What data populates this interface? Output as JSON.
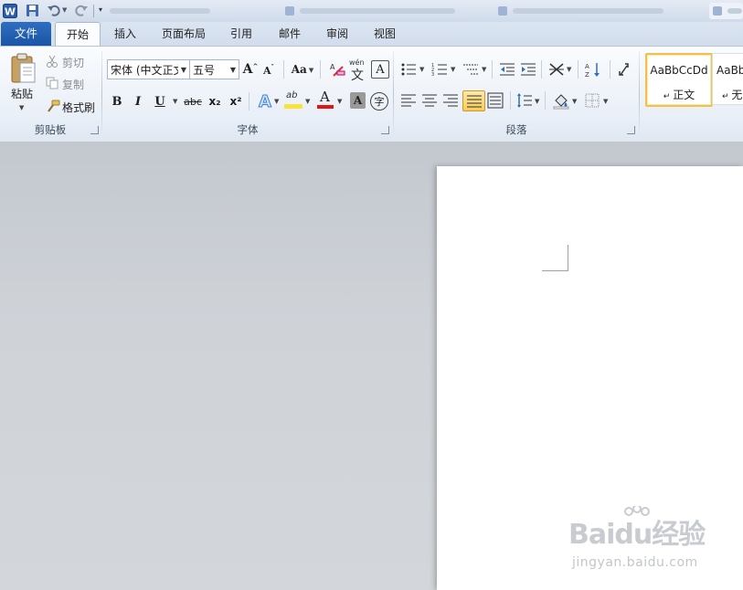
{
  "quick_access": {
    "app_icon": "word-icon",
    "save_icon": "save-icon",
    "undo_icon": "undo-icon",
    "redo_icon": "redo-icon",
    "customize_icon": "customize-qat-icon"
  },
  "tabs": {
    "file": "文件",
    "items": [
      "开始",
      "插入",
      "页面布局",
      "引用",
      "邮件",
      "审阅",
      "视图"
    ],
    "active": "开始"
  },
  "clipboard": {
    "paste": "粘贴",
    "cut": "剪切",
    "copy": "复制",
    "format_painter": "格式刷",
    "group_label": "剪贴板"
  },
  "font": {
    "font_name": "宋体 (中文正文",
    "font_size": "五号",
    "grow": "A",
    "shrink": "A",
    "change_case": "Aa",
    "bold": "B",
    "italic": "I",
    "underline": "U",
    "strikethrough": "abc",
    "subscript": "x₂",
    "superscript": "x²",
    "highlight": "ab",
    "font_color": "A",
    "char_shading": "A",
    "enclose": "字",
    "phonetic": "wén",
    "phonetic_char": "文",
    "group_label": "字体",
    "font_color_value": "#e81414",
    "highlight_color_value": "#f7e33c"
  },
  "paragraph": {
    "group_label": "段落"
  },
  "styles": {
    "normal_preview": "AaBbCcDd",
    "normal_name": "正文",
    "nospace_preview": "AaBb",
    "nospace_name": "无"
  },
  "watermark": {
    "logo": "Baidu经验",
    "url": "jingyan.baidu.com"
  }
}
